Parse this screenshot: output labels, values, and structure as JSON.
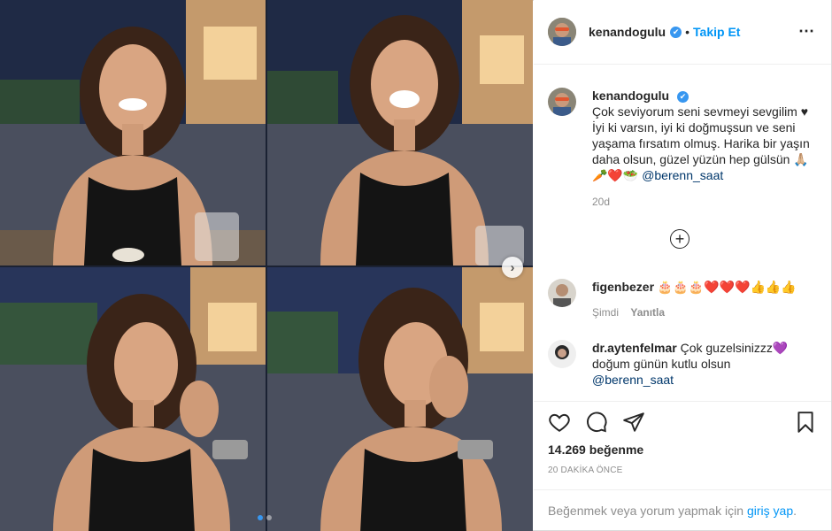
{
  "post": {
    "username": "kenandogulu",
    "verified_badge": "✔",
    "separator": "•",
    "follow_label": "Takip Et",
    "more_icon": "⋯",
    "carousel_next": "›"
  },
  "caption": {
    "username": "kenandogulu",
    "text": "Çok seviyorum seni sevmeyi sevgilim ♥ İyi ki varsın, iyi ki doğmuşsun ve seni yaşama fırsatım olmuş. Harika bir yaşın daha olsun, güzel yüzün hep gülsün 🙏🏼🥕❤️🥗",
    "mention": "@berenn_saat",
    "age": "20d"
  },
  "load_more_icon": "+",
  "comments": [
    {
      "username": "figenbezer",
      "text": "🎂🎂🎂❤️❤️❤️👍👍👍",
      "age": "Şimdi",
      "reply_label": "Yanıtla"
    },
    {
      "username": "dr.aytenfelmar",
      "text": "Çok guzelsinizzz💜 doğum günün kutlu olsun",
      "mention": "@berenn_saat"
    }
  ],
  "footer": {
    "likes": "14.269 beğenme",
    "timestamp": "20 DAKİKA ÖNCE",
    "login_prompt": "Beğenmek veya yorum yapmak için",
    "login_link": "giriş yap",
    "login_suffix": "."
  },
  "colors": {
    "accent": "#0095f6",
    "verified": "#3897f0",
    "mention": "#00376b",
    "muted": "#8e8e8e"
  }
}
